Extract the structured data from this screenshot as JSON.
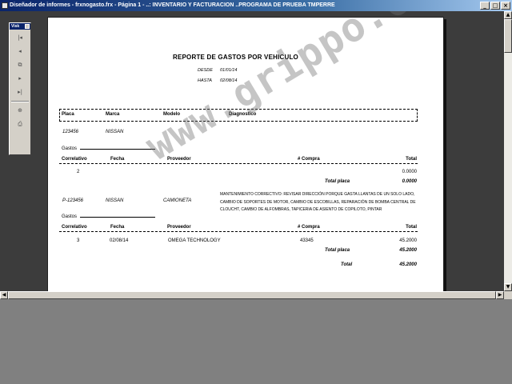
{
  "window": {
    "title": "Diseñador de informes - frxnogasto.frx - Página 1 - ..: INVENTARIO Y FACTURACION ..PROGRAMA DE PRUEBA TMPERRE",
    "controls": [
      "_",
      "□",
      "×"
    ]
  },
  "toolbar": {
    "caption": "Visk",
    "buttons": [
      "first-page-icon",
      "previous-page-icon",
      "go-to-page-icon",
      "next-page-icon",
      "last-page-icon",
      "zoom-icon",
      "print-icon"
    ],
    "glyphs": {
      "first": "|◂",
      "prev": "◂",
      "goto": "⧉",
      "next": "▸",
      "last": "▸|",
      "zoom": "⊕",
      "print": "⎙"
    }
  },
  "report": {
    "title": "REPORTE DE GASTOS POR VEHICULO",
    "desde_label": "DESDE",
    "desde_value": "01/01/14",
    "hasta_label": "HASTA",
    "hasta_value": "02/08/14",
    "columns": {
      "placa": "Placa",
      "marca": "Marca",
      "modelo": "Modelo",
      "diagnostico": "Diagnostico"
    },
    "gastos_label": "Gastos",
    "detail_columns": {
      "correlativo": "Correlativo",
      "fecha": "Fecha",
      "proveedor": "Proveedor",
      "compra": "# Compra",
      "total": "Total"
    },
    "groups": [
      {
        "placa": "123456",
        "marca": "NISSAN",
        "modelo": "",
        "diagnostico": "",
        "rows": [
          {
            "correlativo": "2",
            "fecha": "",
            "proveedor": "",
            "compra": "",
            "total": "0.0000"
          }
        ],
        "total_placa_label": "Total placa",
        "total_placa": "0.0000"
      },
      {
        "placa": "P-123456",
        "marca": "NISSAN",
        "modelo": "CAMIONETA",
        "diagnostico": "MANTENIMIENTO CORRECTIVO: REVISAR DIRECCIÓN PORQUE GASTA LLANTAS DE UN SOLO LADO, CAMBIO DE SOPORTES DE MOTOR, CAMBIO DE ESCOBILLAS, REPARACIÓN DE BOMBA CENTRAL DE CLOUCHT, CAMBIO DE ALFOMBRAS, TAPICERIA DE ASIENTO DE COPILOTO, PINTAR",
        "rows": [
          {
            "correlativo": "3",
            "fecha": "02/08/14",
            "proveedor": "OMEGA TECHNOLOGY",
            "compra": "43345",
            "total": "45.2000"
          }
        ],
        "total_placa_label": "Total placa",
        "total_placa": "45.2000"
      }
    ],
    "grand_total_label": "Total",
    "grand_total": "45.2000"
  },
  "watermark": "www.grippo.com",
  "scrollbars": {
    "up": "▲",
    "down": "▼",
    "left": "◀",
    "right": "▶"
  }
}
